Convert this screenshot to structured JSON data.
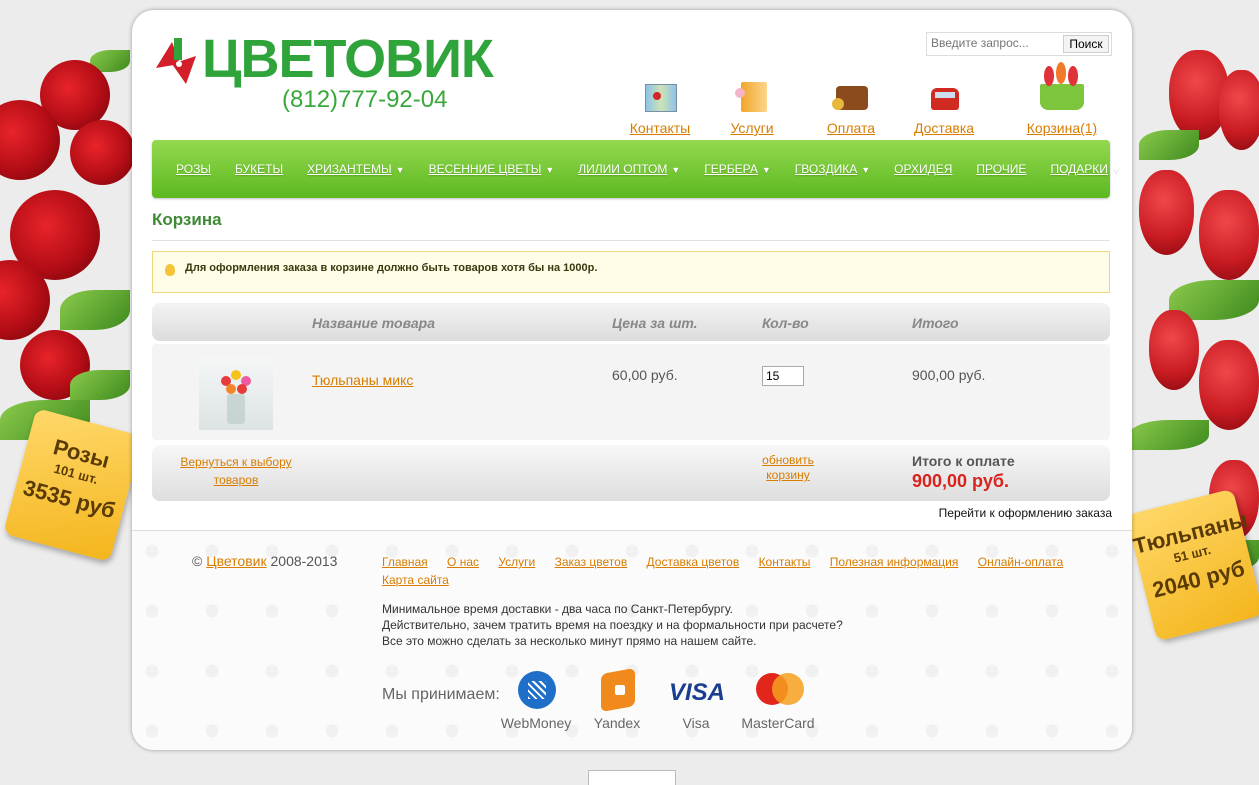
{
  "brand": {
    "name": "ЦВЕТОВИК",
    "phone": "(812)777-92-04",
    "color": "#2ea43b"
  },
  "search": {
    "placeholder": "Введите запрос...",
    "button": "Поиск"
  },
  "topnav": [
    {
      "label": "Контакты",
      "icon": "map-icon"
    },
    {
      "label": "Услуги",
      "icon": "notebook-icon"
    },
    {
      "label": "Оплата",
      "icon": "wallet-icon"
    },
    {
      "label": "Доставка",
      "icon": "car-icon"
    },
    {
      "label": "Корзина(1)",
      "icon": "basket-icon"
    }
  ],
  "menu": [
    {
      "label": "РОЗЫ",
      "dropdown": false
    },
    {
      "label": "БУКЕТЫ",
      "dropdown": false
    },
    {
      "label": "ХРИЗАНТЕМЫ",
      "dropdown": true
    },
    {
      "label": "ВЕСЕННИЕ ЦВЕТЫ",
      "dropdown": true
    },
    {
      "label": "ЛИЛИИ ОПТОМ",
      "dropdown": true
    },
    {
      "label": "ГЕРБЕРА",
      "dropdown": true
    },
    {
      "label": "ГВОЗДИКА",
      "dropdown": true
    },
    {
      "label": "ОРХИДЕЯ",
      "dropdown": false
    },
    {
      "label": "ПРОЧИЕ",
      "dropdown": false
    },
    {
      "label": "ПОДАРКИ",
      "dropdown": true
    }
  ],
  "page_title": "Корзина",
  "notice": "Для оформления заказа в корзине должно быть товаров хотя бы на 1000р.",
  "cart": {
    "headers": {
      "name": "Название товара",
      "price": "Цена за шт.",
      "qty": "Кол-во",
      "total": "Итого"
    },
    "items": [
      {
        "name": "Тюльпаны микс",
        "price": "60,00 руб.",
        "qty": "15",
        "total": "900,00 руб."
      }
    ],
    "back_link": "Вернуться к выбору товаров",
    "update_link": "обновить корзину",
    "sum_label": "Итого к оплате",
    "sum_value": "900,00 руб.",
    "checkout_link": "Перейти к оформлению заказа"
  },
  "tags": {
    "left": {
      "title": "Розы",
      "count": "101 шт.",
      "price": "3535 руб"
    },
    "right": {
      "title": "Тюльпаны",
      "count": "51 шт.",
      "price": "2040 руб"
    }
  },
  "footer": {
    "copyright_symbol": "©",
    "copyright_link": "Цветовик",
    "copyright_years": "2008-2013",
    "links": [
      "Главная",
      "О нас",
      "Услуги",
      "Заказ цветов",
      "Доставка цветов",
      "Контакты",
      "Полезная информация",
      "Онлайн-оплата",
      "Карта сайта"
    ],
    "info": [
      "Минимальное время доставки - два часа по Санкт-Петербургу.",
      "Действительно, зачем тратить время на поездку и на формальности при расчете?",
      "Все это можно сделать за несколько минут прямо на нашем сайте."
    ],
    "accept_label": "Мы принимаем:",
    "payments": [
      {
        "label": "WebMoney",
        "icon": "webmoney-icon",
        "color": "#1f6fc9"
      },
      {
        "label": "Yandex",
        "icon": "yandex-wallet-icon",
        "color": "#f08a1c"
      },
      {
        "label": "Visa",
        "icon": "visa-icon",
        "color": "#1a3d8f"
      },
      {
        "label": "MasterCard",
        "icon": "mastercard-icon",
        "color": "#e3261b"
      }
    ]
  }
}
